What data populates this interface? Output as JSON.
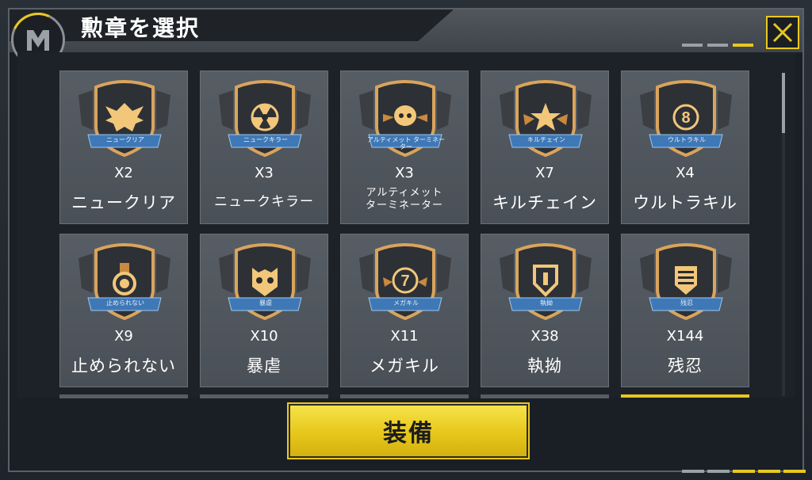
{
  "header": {
    "title": "勲章を選択"
  },
  "colors": {
    "accent": "#e8c820",
    "card": "#52585f",
    "background": "#1c2229"
  },
  "medals": [
    {
      "banner": "ニュークリア",
      "count": "X2",
      "name": "ニュークリア",
      "emblem": "eagle"
    },
    {
      "banner": "ニュークキラー",
      "count": "X3",
      "name": "ニュークキラー",
      "emblem": "radiation"
    },
    {
      "banner": "アルティメット ターミネーター",
      "count": "X3",
      "name": "アルティメット\nターミネーター",
      "emblem": "skull"
    },
    {
      "banner": "キルチェイン",
      "count": "X7",
      "name": "キルチェイン",
      "emblem": "star"
    },
    {
      "banner": "ウルトラキル",
      "count": "X4",
      "name": "ウルトラキル",
      "emblem": "number-8"
    },
    {
      "banner": "止められない",
      "count": "X9",
      "name": "止められない",
      "emblem": "medal"
    },
    {
      "banner": "暴虐",
      "count": "X10",
      "name": "暴虐",
      "emblem": "owl"
    },
    {
      "banner": "メガキル",
      "count": "X11",
      "name": "メガキル",
      "emblem": "number-7"
    },
    {
      "banner": "執拗",
      "count": "X38",
      "name": "執拗",
      "emblem": "chevron"
    },
    {
      "banner": "残忍",
      "count": "X144",
      "name": "残忍",
      "emblem": "stripes"
    }
  ],
  "footer": {
    "equip_label": "装備"
  }
}
